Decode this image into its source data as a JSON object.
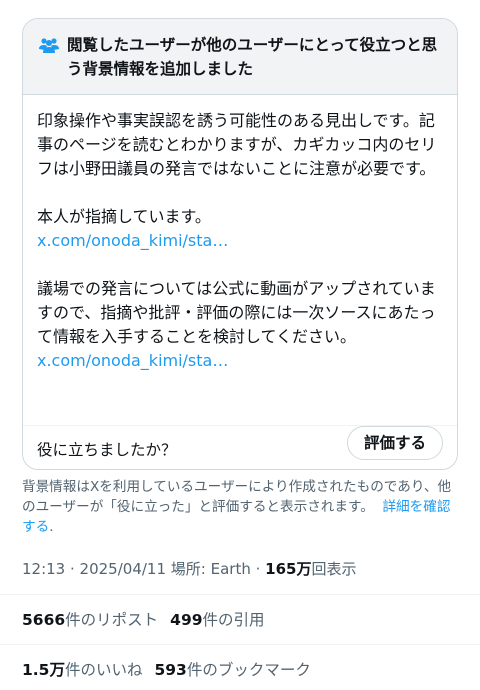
{
  "note": {
    "title": "閲覧したユーザーが他のユーザーにとって役立つと思う背景情報を追加しました",
    "paragraph1": "印象操作や事実誤認を誘う可能性のある見出しです。記事のページを読むとわかりますが、カギカッコ内のセリフは小野田議員の発言ではないことに注意が必要です。",
    "paragraph2": "本人が指摘しています。",
    "link1": "x.com/onoda_kimi/sta…",
    "paragraph3": "議場での発言については公式に動画がアップされていますので、指摘や批評・評価の際には一次ソースにあたって情報を入手することを検討してください。",
    "link2": "x.com/onoda_kimi/sta…",
    "helpful_question": "役に立ちましたか？",
    "rate_button": "評価する"
  },
  "footnote": {
    "text": "背景情報はXを利用しているユーザーにより作成されたものであり、他のユーザーが「役に立った」と評価すると表示されます。",
    "link": "詳細を確認する",
    "period": "."
  },
  "meta": {
    "time": "12:13",
    "dot1": " · ",
    "date": "2025/04/11",
    "location": " 場所: Earth",
    "dot2": " · ",
    "views_count": "165万",
    "views_label": "回表示"
  },
  "stats": {
    "reposts_count": "5666",
    "reposts_label": "件のリポスト",
    "quotes_count": "499",
    "quotes_label": "件の引用",
    "likes_count": "1.5万",
    "likes_label": "件のいいね",
    "bookmarks_count": "593",
    "bookmarks_label": "件のブックマーク"
  },
  "colors": {
    "link": "#1d9bf0",
    "muted": "#536471",
    "header_bg": "#f2f3f4",
    "icon": "#1d9bf0"
  },
  "icons": {
    "header": "people-icon"
  }
}
